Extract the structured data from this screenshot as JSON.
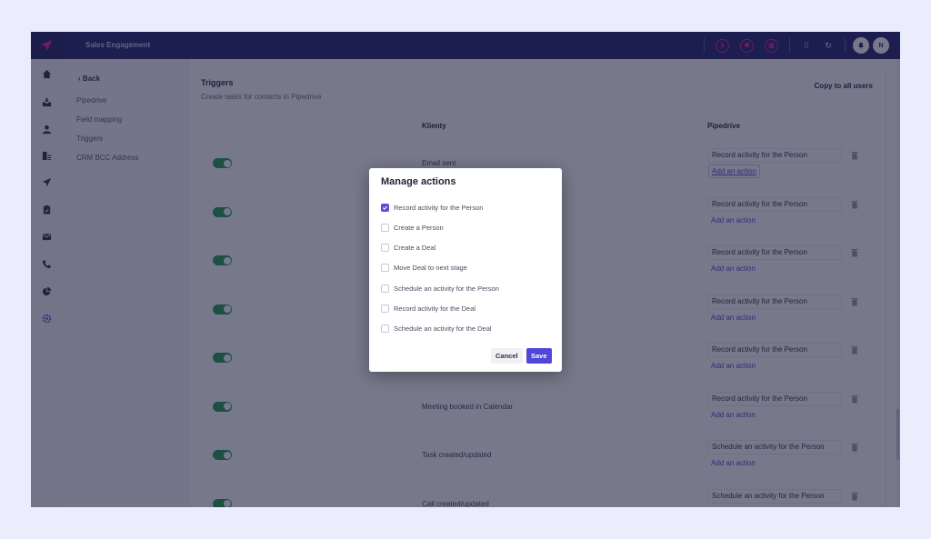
{
  "colors": {
    "topbar": "#1c1f6b",
    "accent": "#5046d8",
    "toggle_on": "#1f9a4b",
    "link": "#4b44d6",
    "notification_ring": "#e0218a",
    "page_background": "#ecedfc"
  },
  "topbar": {
    "logo_icon": "paper-plane-icon",
    "app_name": "Sales Engagement",
    "icons": [
      {
        "name": "dollar-icon",
        "glyph": "$"
      },
      {
        "name": "user-icon",
        "glyph": "⚉"
      },
      {
        "name": "calendar-icon",
        "glyph": "▦"
      }
    ],
    "utility_icons": [
      {
        "name": "keyboard-icon",
        "glyph": "⁞⁞"
      },
      {
        "name": "refresh-icon",
        "glyph": "↻"
      }
    ],
    "bell_icon": "bell-icon",
    "avatar_initial": "N"
  },
  "rail": {
    "items": [
      {
        "name": "home-icon",
        "active": false
      },
      {
        "name": "inbox-icon",
        "active": false
      },
      {
        "name": "contacts-icon",
        "active": false
      },
      {
        "name": "companies-icon",
        "active": false
      },
      {
        "name": "campaigns-icon",
        "active": false
      },
      {
        "name": "tasks-icon",
        "active": false
      },
      {
        "name": "email-icon",
        "active": false
      },
      {
        "name": "phone-icon",
        "active": false
      },
      {
        "name": "reports-icon",
        "active": false
      },
      {
        "name": "settings-icon",
        "active": true
      }
    ]
  },
  "subnav": {
    "back_label": "‹ Back",
    "items": [
      "Pipedrive",
      "Field mapping",
      "Triggers",
      "CRM BCC Address"
    ]
  },
  "content": {
    "title": "Triggers",
    "subtitle": "Create tasks for contacts in Pipedrive",
    "copy_button": "Copy to all users",
    "columns": {
      "klienty": "Klienty",
      "pipedrive": "Pipedrive"
    },
    "add_action_label": "Add an action",
    "rows": [
      {
        "enabled": true,
        "trigger": "Email sent",
        "action": "Record activity for the Person"
      },
      {
        "enabled": true,
        "trigger": "",
        "action": "Record activity for the Person"
      },
      {
        "enabled": true,
        "trigger": "",
        "action": "Record activity for the Person"
      },
      {
        "enabled": true,
        "trigger": "",
        "action": "Record activity for the Person"
      },
      {
        "enabled": true,
        "trigger": "",
        "action": "Record activity for the Person"
      },
      {
        "enabled": true,
        "trigger": "Meeting booked in Calendar",
        "action": "Record activity for the Person"
      },
      {
        "enabled": true,
        "trigger": "Task created/updated",
        "action": "Schedule an activity for the Person"
      },
      {
        "enabled": true,
        "trigger": "Call created/updated",
        "action": "Schedule an activity for the Person"
      }
    ]
  },
  "modal": {
    "title": "Manage actions",
    "options": [
      {
        "label": "Record activity for the Person",
        "checked": true
      },
      {
        "label": "Create a Person",
        "checked": false
      },
      {
        "label": "Create a Deal",
        "checked": false
      },
      {
        "label": "Move Deal to next stage",
        "checked": false
      },
      {
        "label": "Schedule an activity for the Person",
        "checked": false
      },
      {
        "label": "Record activity for the Deal",
        "checked": false
      },
      {
        "label": "Schedule an activity for the Deal",
        "checked": false
      }
    ],
    "cancel_label": "Cancel",
    "save_label": "Save"
  }
}
